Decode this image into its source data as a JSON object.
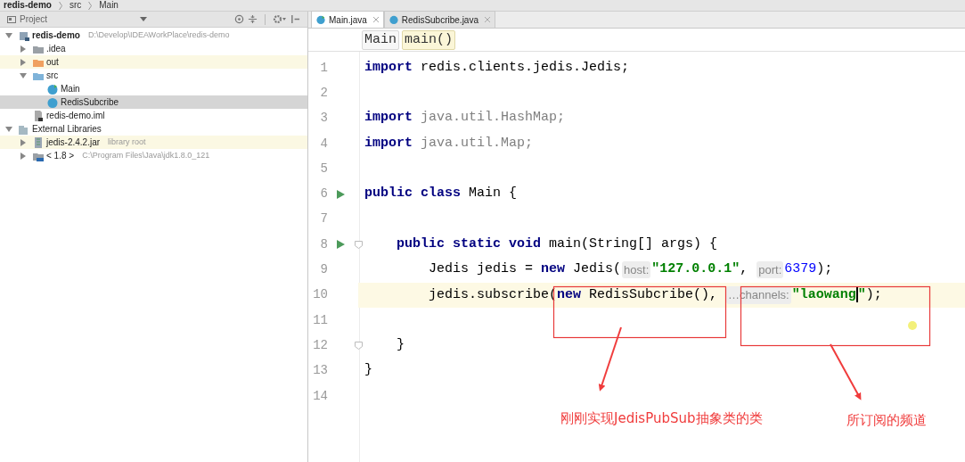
{
  "nav_bar": {
    "items": [
      "redis-demo",
      "src",
      "Main"
    ]
  },
  "project_panel": {
    "title": "Project",
    "tree": [
      {
        "label": "redis-demo",
        "detail": "D:\\Develop\\IDEAWorkPlace\\redis-demo",
        "kind": "module",
        "expanded": true,
        "selected": false,
        "highlighted": false,
        "children": [
          {
            "label": ".idea",
            "kind": "folder",
            "expanded": false,
            "selected": false,
            "highlighted": false
          },
          {
            "label": "out",
            "kind": "excluded-folder",
            "expanded": false,
            "selected": false,
            "highlighted": true
          },
          {
            "label": "src",
            "kind": "source-folder",
            "expanded": true,
            "selected": false,
            "highlighted": false,
            "children": [
              {
                "label": "Main",
                "kind": "runnable-class",
                "selected": false,
                "highlighted": false
              },
              {
                "label": "RedisSubcribe",
                "kind": "class",
                "selected": true,
                "highlighted": false
              }
            ]
          },
          {
            "label": "redis-demo.iml",
            "kind": "file",
            "selected": false,
            "highlighted": false
          }
        ]
      },
      {
        "label": "External Libraries",
        "kind": "libraries",
        "expanded": true,
        "selected": false,
        "highlighted": false,
        "children": [
          {
            "label": "jedis-2.4.2.jar",
            "detail": "library root",
            "kind": "jar",
            "expanded": false,
            "selected": false,
            "highlighted": true
          },
          {
            "label": "< 1.8 >",
            "detail": "C:\\Program Files\\Java\\jdk1.8.0_121",
            "kind": "jdk",
            "expanded": false,
            "selected": false,
            "highlighted": false
          }
        ]
      }
    ]
  },
  "tabs": [
    {
      "label": "Main.java",
      "selected": true
    },
    {
      "label": "RedisSubcribe.java",
      "selected": false
    }
  ],
  "editor_breadcrumb": [
    {
      "label": "Main",
      "selected": false
    },
    {
      "label": "main()",
      "selected": true
    }
  ],
  "code_lines": [
    {
      "number": "1",
      "tokens": [
        {
          "kind": "keyword",
          "text": "import"
        },
        {
          "kind": "plain",
          "text": " redis.clients.jedis.Jedis;"
        }
      ]
    },
    {
      "number": "2"
    },
    {
      "number": "3",
      "tokens": [
        {
          "kind": "keyword",
          "text": "import"
        },
        {
          "kind": "unused",
          "text": " java.util.HashMap;"
        }
      ]
    },
    {
      "number": "4",
      "tokens": [
        {
          "kind": "keyword",
          "text": "import"
        },
        {
          "kind": "unused",
          "text": " java.util.Map;"
        }
      ]
    },
    {
      "number": "5"
    },
    {
      "number": "6",
      "run_marker": true,
      "tokens": [
        {
          "kind": "keyword",
          "text": "public class"
        },
        {
          "kind": "plain",
          "text": " Main {"
        }
      ]
    },
    {
      "number": "7"
    },
    {
      "number": "8",
      "run_marker": true,
      "fold_marker": true,
      "tokens": [
        {
          "kind": "keyword",
          "text": "public static void"
        },
        {
          "kind": "plain",
          "text": " main(String[] args) {"
        }
      ]
    },
    {
      "number": "9",
      "tokens": [
        {
          "kind": "plain",
          "text": "Jedis jedis = "
        },
        {
          "kind": "keyword",
          "text": "new"
        },
        {
          "kind": "plain",
          "text": " Jedis("
        },
        {
          "kind": "hint",
          "text": "host:"
        },
        {
          "kind": "string",
          "text": "\"127.0.0.1\""
        },
        {
          "kind": "plain",
          "text": ", "
        },
        {
          "kind": "hint",
          "text": "port:"
        },
        {
          "kind": "number",
          "text": "6379"
        },
        {
          "kind": "plain",
          "text": ");"
        }
      ]
    },
    {
      "number": "10",
      "current": true,
      "tokens": [
        {
          "kind": "plain",
          "text": "jedis.subscribe("
        },
        {
          "kind": "keyword",
          "text": "new"
        },
        {
          "kind": "plain",
          "text": " RedisSubcribe(), "
        },
        {
          "kind": "hint",
          "text": "…channels:"
        },
        {
          "kind": "string",
          "text": "\"laowang",
          "caret_after": true
        },
        {
          "kind": "string",
          "text": "\""
        },
        {
          "kind": "plain",
          "text": ");"
        }
      ]
    },
    {
      "number": "11"
    },
    {
      "number": "12",
      "fold_marker": true,
      "tokens": [
        {
          "kind": "plain",
          "text": "}"
        }
      ]
    },
    {
      "number": "13",
      "tokens": [
        {
          "kind": "plain",
          "text": "}"
        }
      ]
    },
    {
      "number": "14"
    }
  ],
  "annotations": [
    {
      "text": "刚刚实现JedisPubSub抽象类的类"
    },
    {
      "text": "所订阅的频道"
    }
  ]
}
